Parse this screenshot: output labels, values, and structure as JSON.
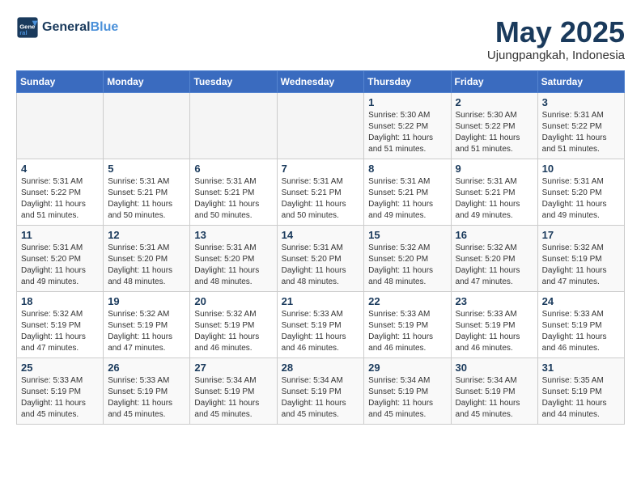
{
  "header": {
    "logo_general": "General",
    "logo_blue": "Blue",
    "month": "May 2025",
    "location": "Ujungpangkah, Indonesia"
  },
  "weekdays": [
    "Sunday",
    "Monday",
    "Tuesday",
    "Wednesday",
    "Thursday",
    "Friday",
    "Saturday"
  ],
  "weeks": [
    [
      {
        "day": "",
        "info": ""
      },
      {
        "day": "",
        "info": ""
      },
      {
        "day": "",
        "info": ""
      },
      {
        "day": "",
        "info": ""
      },
      {
        "day": "1",
        "info": "Sunrise: 5:30 AM\nSunset: 5:22 PM\nDaylight: 11 hours\nand 51 minutes."
      },
      {
        "day": "2",
        "info": "Sunrise: 5:30 AM\nSunset: 5:22 PM\nDaylight: 11 hours\nand 51 minutes."
      },
      {
        "day": "3",
        "info": "Sunrise: 5:31 AM\nSunset: 5:22 PM\nDaylight: 11 hours\nand 51 minutes."
      }
    ],
    [
      {
        "day": "4",
        "info": "Sunrise: 5:31 AM\nSunset: 5:22 PM\nDaylight: 11 hours\nand 51 minutes."
      },
      {
        "day": "5",
        "info": "Sunrise: 5:31 AM\nSunset: 5:21 PM\nDaylight: 11 hours\nand 50 minutes."
      },
      {
        "day": "6",
        "info": "Sunrise: 5:31 AM\nSunset: 5:21 PM\nDaylight: 11 hours\nand 50 minutes."
      },
      {
        "day": "7",
        "info": "Sunrise: 5:31 AM\nSunset: 5:21 PM\nDaylight: 11 hours\nand 50 minutes."
      },
      {
        "day": "8",
        "info": "Sunrise: 5:31 AM\nSunset: 5:21 PM\nDaylight: 11 hours\nand 49 minutes."
      },
      {
        "day": "9",
        "info": "Sunrise: 5:31 AM\nSunset: 5:21 PM\nDaylight: 11 hours\nand 49 minutes."
      },
      {
        "day": "10",
        "info": "Sunrise: 5:31 AM\nSunset: 5:20 PM\nDaylight: 11 hours\nand 49 minutes."
      }
    ],
    [
      {
        "day": "11",
        "info": "Sunrise: 5:31 AM\nSunset: 5:20 PM\nDaylight: 11 hours\nand 49 minutes."
      },
      {
        "day": "12",
        "info": "Sunrise: 5:31 AM\nSunset: 5:20 PM\nDaylight: 11 hours\nand 48 minutes."
      },
      {
        "day": "13",
        "info": "Sunrise: 5:31 AM\nSunset: 5:20 PM\nDaylight: 11 hours\nand 48 minutes."
      },
      {
        "day": "14",
        "info": "Sunrise: 5:31 AM\nSunset: 5:20 PM\nDaylight: 11 hours\nand 48 minutes."
      },
      {
        "day": "15",
        "info": "Sunrise: 5:32 AM\nSunset: 5:20 PM\nDaylight: 11 hours\nand 48 minutes."
      },
      {
        "day": "16",
        "info": "Sunrise: 5:32 AM\nSunset: 5:20 PM\nDaylight: 11 hours\nand 47 minutes."
      },
      {
        "day": "17",
        "info": "Sunrise: 5:32 AM\nSunset: 5:19 PM\nDaylight: 11 hours\nand 47 minutes."
      }
    ],
    [
      {
        "day": "18",
        "info": "Sunrise: 5:32 AM\nSunset: 5:19 PM\nDaylight: 11 hours\nand 47 minutes."
      },
      {
        "day": "19",
        "info": "Sunrise: 5:32 AM\nSunset: 5:19 PM\nDaylight: 11 hours\nand 47 minutes."
      },
      {
        "day": "20",
        "info": "Sunrise: 5:32 AM\nSunset: 5:19 PM\nDaylight: 11 hours\nand 46 minutes."
      },
      {
        "day": "21",
        "info": "Sunrise: 5:33 AM\nSunset: 5:19 PM\nDaylight: 11 hours\nand 46 minutes."
      },
      {
        "day": "22",
        "info": "Sunrise: 5:33 AM\nSunset: 5:19 PM\nDaylight: 11 hours\nand 46 minutes."
      },
      {
        "day": "23",
        "info": "Sunrise: 5:33 AM\nSunset: 5:19 PM\nDaylight: 11 hours\nand 46 minutes."
      },
      {
        "day": "24",
        "info": "Sunrise: 5:33 AM\nSunset: 5:19 PM\nDaylight: 11 hours\nand 46 minutes."
      }
    ],
    [
      {
        "day": "25",
        "info": "Sunrise: 5:33 AM\nSunset: 5:19 PM\nDaylight: 11 hours\nand 45 minutes."
      },
      {
        "day": "26",
        "info": "Sunrise: 5:33 AM\nSunset: 5:19 PM\nDaylight: 11 hours\nand 45 minutes."
      },
      {
        "day": "27",
        "info": "Sunrise: 5:34 AM\nSunset: 5:19 PM\nDaylight: 11 hours\nand 45 minutes."
      },
      {
        "day": "28",
        "info": "Sunrise: 5:34 AM\nSunset: 5:19 PM\nDaylight: 11 hours\nand 45 minutes."
      },
      {
        "day": "29",
        "info": "Sunrise: 5:34 AM\nSunset: 5:19 PM\nDaylight: 11 hours\nand 45 minutes."
      },
      {
        "day": "30",
        "info": "Sunrise: 5:34 AM\nSunset: 5:19 PM\nDaylight: 11 hours\nand 45 minutes."
      },
      {
        "day": "31",
        "info": "Sunrise: 5:35 AM\nSunset: 5:19 PM\nDaylight: 11 hours\nand 44 minutes."
      }
    ]
  ]
}
